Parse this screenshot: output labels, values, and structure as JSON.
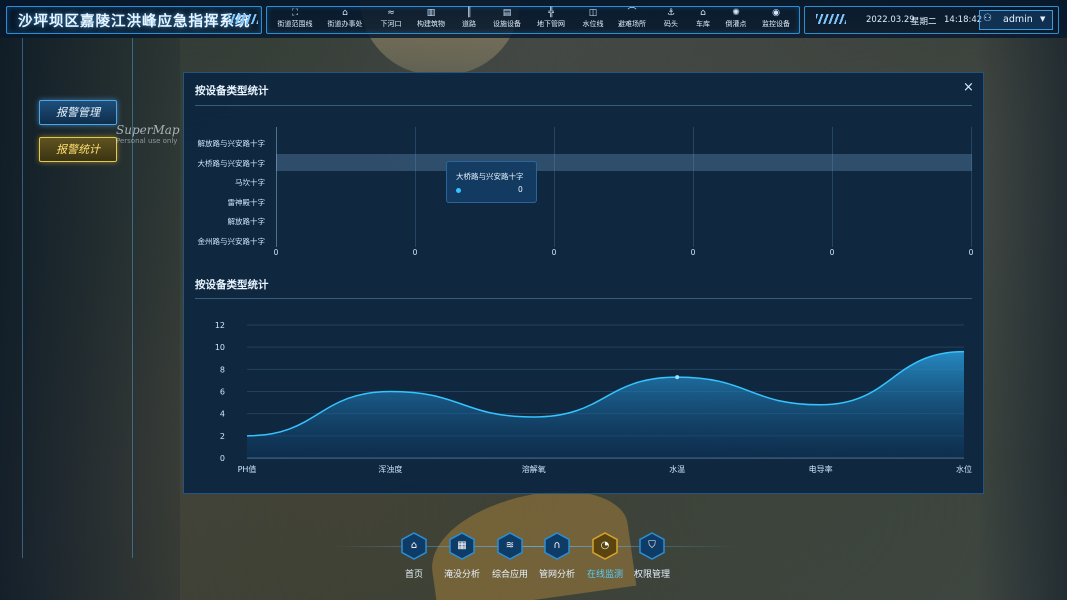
{
  "app": {
    "title": "沙坪坝区嘉陵江洪峰应急指挥系统"
  },
  "topnav": {
    "items": [
      {
        "label": "街道范围线",
        "icon": "boundary-icon",
        "glyph": "⛶"
      },
      {
        "label": "街道办事处",
        "icon": "office-icon",
        "glyph": "⌂"
      },
      {
        "label": "下河口",
        "icon": "river-mouth-icon",
        "glyph": "≈"
      },
      {
        "label": "构建筑物",
        "icon": "building-icon",
        "glyph": "▥"
      },
      {
        "label": "道路",
        "icon": "road-icon",
        "glyph": "║"
      },
      {
        "label": "设施设备",
        "icon": "facility-icon",
        "glyph": "▤"
      },
      {
        "label": "地下管网",
        "icon": "pipe-network-icon",
        "glyph": "╬"
      },
      {
        "label": "水位线",
        "icon": "water-level-icon",
        "glyph": "◫"
      },
      {
        "label": "避难场所",
        "icon": "shelter-icon",
        "glyph": "⌒"
      },
      {
        "label": "码头",
        "icon": "dock-icon",
        "glyph": "⚓"
      },
      {
        "label": "车库",
        "icon": "garage-icon",
        "glyph": "⌂"
      },
      {
        "label": "倒灌点",
        "icon": "backflow-icon",
        "glyph": "✺"
      },
      {
        "label": "监控设备",
        "icon": "camera-icon",
        "glyph": "◉"
      }
    ]
  },
  "header": {
    "date": "2022.03.29",
    "weekday": "星期二",
    "time": "14:18:42",
    "user": "admin"
  },
  "sidebar": {
    "items": [
      {
        "label": "报警管理",
        "active": false
      },
      {
        "label": "报警统计",
        "active": true
      }
    ]
  },
  "watermark": {
    "brand": "SuperMap",
    "sub": "Personal use only"
  },
  "panel": {
    "title1": "按设备类型统计",
    "title2": "按设备类型统计",
    "close": "×"
  },
  "bar_chart": {
    "type": "bar",
    "orientation": "horizontal",
    "categories": [
      "解放路与兴安路十字",
      "大桥路与兴安路十字",
      "马坎十字",
      "雷神殿十字",
      "解放路十字",
      "金州路与兴安路十字"
    ],
    "values": [
      0,
      0,
      0,
      0,
      0,
      0
    ],
    "x_ticks": [
      "0",
      "0",
      "0",
      "0",
      "0",
      "0"
    ],
    "highlight_index": 1,
    "tooltip": {
      "title": "大桥路与兴安路十字",
      "value": "0"
    },
    "accent": "#35c4ff"
  },
  "chart_data": {
    "type": "area",
    "categories": [
      "PH值",
      "浑浊度",
      "溶解氧",
      "水温",
      "电导率",
      "水位"
    ],
    "values": [
      2,
      6,
      3.7,
      7.3,
      4.8,
      9.6
    ],
    "ylim": [
      0,
      12
    ],
    "y_ticks": [
      0,
      2,
      4,
      6,
      8,
      10,
      12
    ],
    "smooth": true,
    "grid": true,
    "color": "#35c4ff"
  },
  "bottomnav": {
    "items": [
      {
        "label": "首页",
        "icon": "home-icon",
        "glyph": "⌂",
        "active": false
      },
      {
        "label": "淹没分析",
        "icon": "flood-analysis-icon",
        "glyph": "▦",
        "active": false
      },
      {
        "label": "综合应用",
        "icon": "layers-icon",
        "glyph": "≋",
        "active": false
      },
      {
        "label": "管网分析",
        "icon": "pipe-icon",
        "glyph": "∩",
        "active": false
      },
      {
        "label": "在线监测",
        "icon": "gauge-icon",
        "glyph": "◔",
        "active": true
      },
      {
        "label": "权限管理",
        "icon": "shield-icon",
        "glyph": "⛉",
        "active": false
      }
    ]
  }
}
